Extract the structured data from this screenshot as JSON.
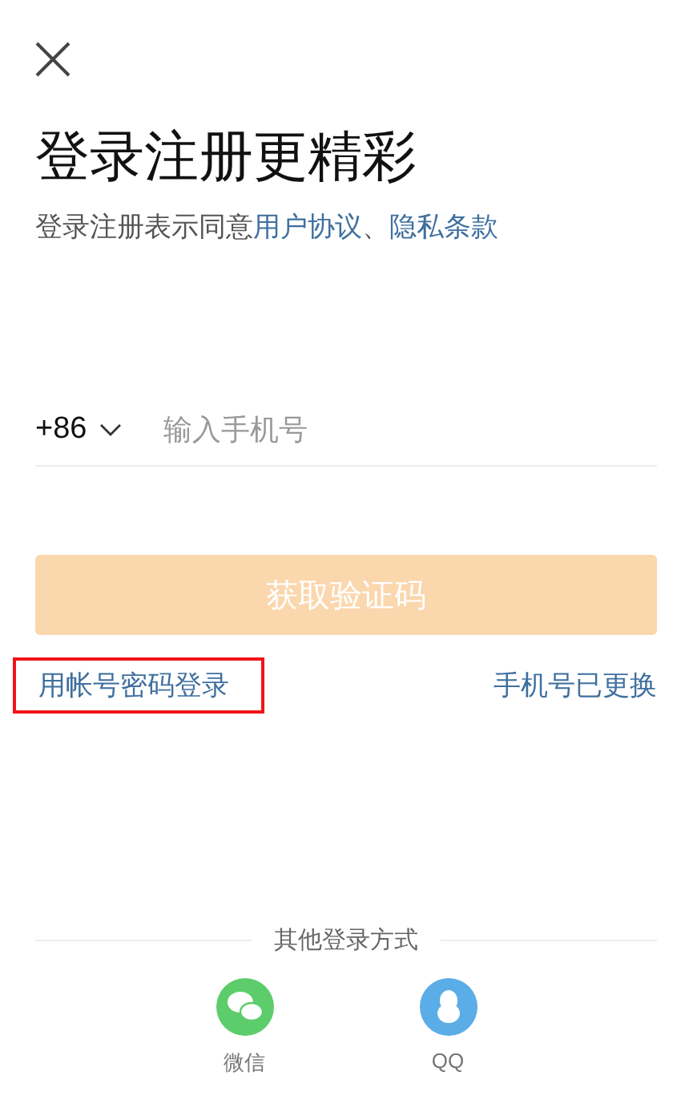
{
  "title": "登录注册更精彩",
  "agreement": {
    "prefix": "登录注册表示同意",
    "links": [
      "用户协议",
      "隐私条款"
    ],
    "separator": "、"
  },
  "phone": {
    "country_code": "+86",
    "placeholder": "输入手机号"
  },
  "submit": {
    "label": "获取验证码",
    "disabled": true
  },
  "links": {
    "password_login": {
      "label": "用帐号密码登录",
      "highlighted": true
    },
    "phone_changed": "手机号已更换"
  },
  "other_login": {
    "heading": "其他登录方式",
    "options": [
      {
        "kind": "wechat",
        "label": "微信",
        "color": "#5ccd6a"
      },
      {
        "kind": "qq",
        "label": "QQ",
        "color": "#5aade6"
      }
    ]
  }
}
